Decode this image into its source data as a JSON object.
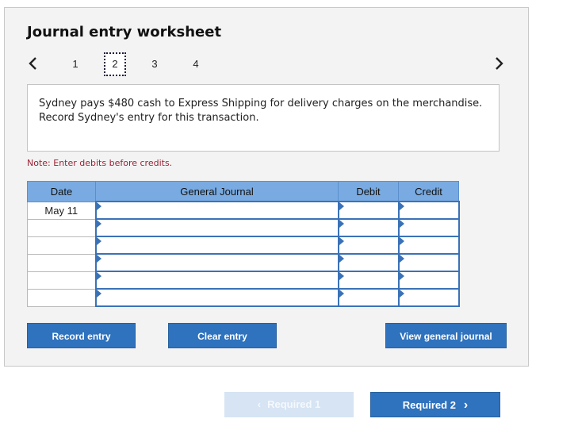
{
  "worksheet": {
    "title": "Journal entry worksheet",
    "pages": [
      "1",
      "2",
      "3",
      "4"
    ],
    "active_page": "2",
    "prompt": "Sydney pays $480 cash to Express Shipping for delivery charges on the merchandise. Record Sydney's entry for this transaction.",
    "note": "Note: Enter debits before credits."
  },
  "table": {
    "headers": [
      "Date",
      "General Journal",
      "Debit",
      "Credit"
    ],
    "rows": [
      {
        "date": "May 11",
        "account": "",
        "debit": "",
        "credit": ""
      },
      {
        "date": "",
        "account": "",
        "debit": "",
        "credit": ""
      },
      {
        "date": "",
        "account": "",
        "debit": "",
        "credit": ""
      },
      {
        "date": "",
        "account": "",
        "debit": "",
        "credit": ""
      },
      {
        "date": "",
        "account": "",
        "debit": "",
        "credit": ""
      },
      {
        "date": "",
        "account": "",
        "debit": "",
        "credit": ""
      }
    ]
  },
  "buttons": {
    "record": "Record entry",
    "clear": "Clear entry",
    "view": "View general journal"
  },
  "footer": {
    "prev": "Required 1",
    "next": "Required 2"
  },
  "colors": {
    "header_bg": "#79abe2",
    "button_bg": "#2f72bd",
    "note_text": "#9b2335"
  }
}
